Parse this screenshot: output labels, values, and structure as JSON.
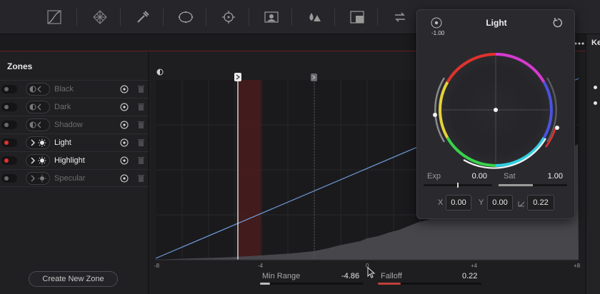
{
  "toolbar": {
    "tools": [
      {
        "icon": "curves-icon"
      },
      {
        "icon": "color-warper-icon"
      },
      {
        "icon": "qualifier-icon"
      },
      {
        "icon": "power-window-icon"
      },
      {
        "icon": "tracker-icon"
      },
      {
        "icon": "magic-mask-icon"
      },
      {
        "icon": "blur-icon"
      },
      {
        "icon": "key-icon"
      },
      {
        "icon": "sizing-icon"
      }
    ]
  },
  "zones": {
    "title": "Zones",
    "items": [
      {
        "label": "Black",
        "enabled": false,
        "active": false
      },
      {
        "label": "Dark",
        "enabled": false,
        "active": false
      },
      {
        "label": "Shadow",
        "enabled": false,
        "active": false
      },
      {
        "label": "Light",
        "enabled": true,
        "active": true
      },
      {
        "label": "Highlight",
        "enabled": true,
        "active": true
      },
      {
        "label": "Specular",
        "enabled": false,
        "active": false
      }
    ],
    "create_button": "Create New Zone"
  },
  "graph": {
    "x_ticks": [
      "-8",
      "-4",
      "0",
      "+4",
      "+8"
    ],
    "colors": {
      "curve": "#6f9ad6",
      "selected_zone": "#7a2a28",
      "histogram": "#4a4a4e"
    }
  },
  "range": {
    "min_label": "Min Range",
    "min_value": "-4.86",
    "falloff_label": "Falloff",
    "falloff_value": "0.22"
  },
  "light_panel": {
    "title": "Light",
    "wheel_value": "-1.00",
    "exp_label": "Exp",
    "exp_value": "0.00",
    "sat_label": "Sat",
    "sat_value": "1.00",
    "x_label": "X",
    "x_value": "0.00",
    "y_label": "Y",
    "y_value": "0.00",
    "falloff_value": "0.22"
  },
  "right_strip": {
    "label": "Ke"
  }
}
